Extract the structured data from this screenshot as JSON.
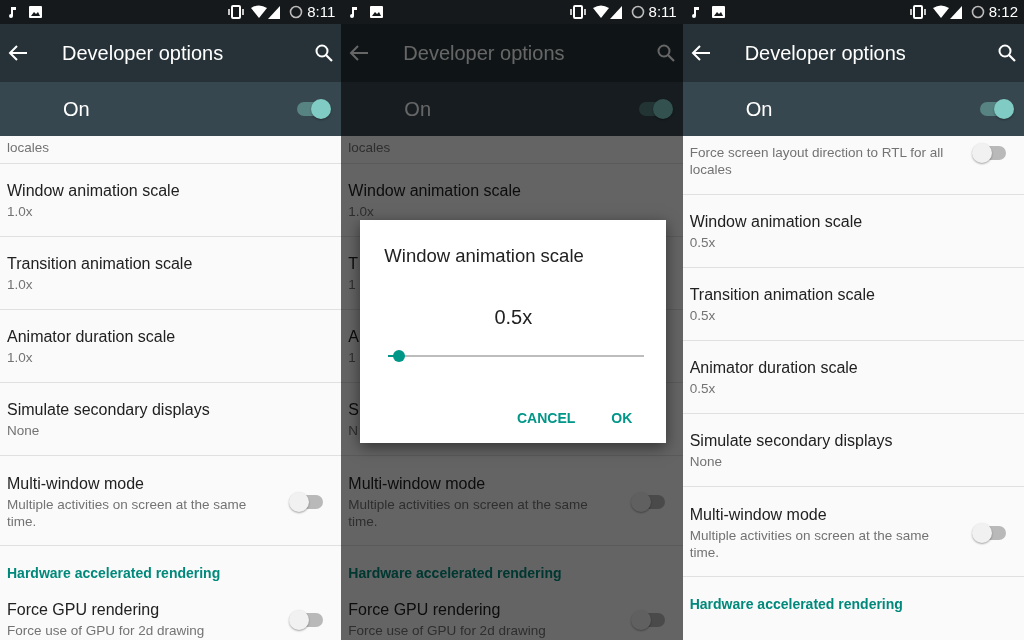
{
  "screens": [
    {
      "status_bar": {
        "time": "8:11"
      },
      "toolbar": {
        "title": "Developer options"
      },
      "master_switch": {
        "label": "On",
        "on": true
      },
      "list": [
        {
          "kind": "partial",
          "summary": "locales"
        },
        {
          "kind": "setting",
          "title": "Window animation scale",
          "summary": "1.0x"
        },
        {
          "kind": "setting",
          "title": "Transition animation scale",
          "summary": "1.0x"
        },
        {
          "kind": "setting",
          "title": "Animator duration scale",
          "summary": "1.0x"
        },
        {
          "kind": "setting",
          "title": "Simulate secondary displays",
          "summary": "None"
        },
        {
          "kind": "toggle",
          "title": "Multi-window mode",
          "summary": "Multiple activities on screen at the same time.",
          "on": false
        },
        {
          "kind": "header",
          "title": "Hardware accelerated rendering"
        },
        {
          "kind": "toggle",
          "title": "Force GPU rendering",
          "summary": "Force use of GPU for 2d drawing",
          "on": false
        }
      ]
    },
    {
      "status_bar": {
        "time": "8:11"
      },
      "toolbar": {
        "title": "Developer options"
      },
      "master_switch": {
        "label": "On",
        "on": true
      },
      "dimmed": true,
      "list": [
        {
          "kind": "partial",
          "summary": "locales"
        },
        {
          "kind": "setting",
          "title": "Window animation scale",
          "summary": "1.0x"
        },
        {
          "kind": "setting",
          "title": "T",
          "summary": "1"
        },
        {
          "kind": "setting",
          "title": "A",
          "summary": "1"
        },
        {
          "kind": "setting",
          "title": "S",
          "summary": "N"
        },
        {
          "kind": "toggle",
          "title": "Multi-window mode",
          "summary": "Multiple activities on screen at the same time.",
          "on": false
        },
        {
          "kind": "header",
          "title": "Hardware accelerated rendering"
        },
        {
          "kind": "toggle",
          "title": "Force GPU rendering",
          "summary": "Force use of GPU for 2d drawing",
          "on": false
        }
      ],
      "dialog": {
        "title": "Window animation scale",
        "value": "0.5x",
        "level": 0.04,
        "buttons": [
          "CANCEL",
          "OK"
        ]
      }
    },
    {
      "status_bar": {
        "time": "8:12"
      },
      "toolbar": {
        "title": "Developer options"
      },
      "master_switch": {
        "label": "On",
        "on": true
      },
      "list": [
        {
          "kind": "cut-toggle",
          "summary": "Force screen layout direction to RTL for all locales",
          "on": false
        },
        {
          "kind": "setting",
          "title": "Window animation scale",
          "summary": "0.5x"
        },
        {
          "kind": "setting",
          "title": "Transition animation scale",
          "summary": "0.5x"
        },
        {
          "kind": "setting",
          "title": "Animator duration scale",
          "summary": "0.5x"
        },
        {
          "kind": "setting",
          "title": "Simulate secondary displays",
          "summary": "None"
        },
        {
          "kind": "toggle",
          "title": "Multi-window mode",
          "summary": "Multiple activities on screen at the same time.",
          "on": false
        },
        {
          "kind": "header",
          "title": "Hardware accelerated rendering"
        }
      ]
    }
  ]
}
